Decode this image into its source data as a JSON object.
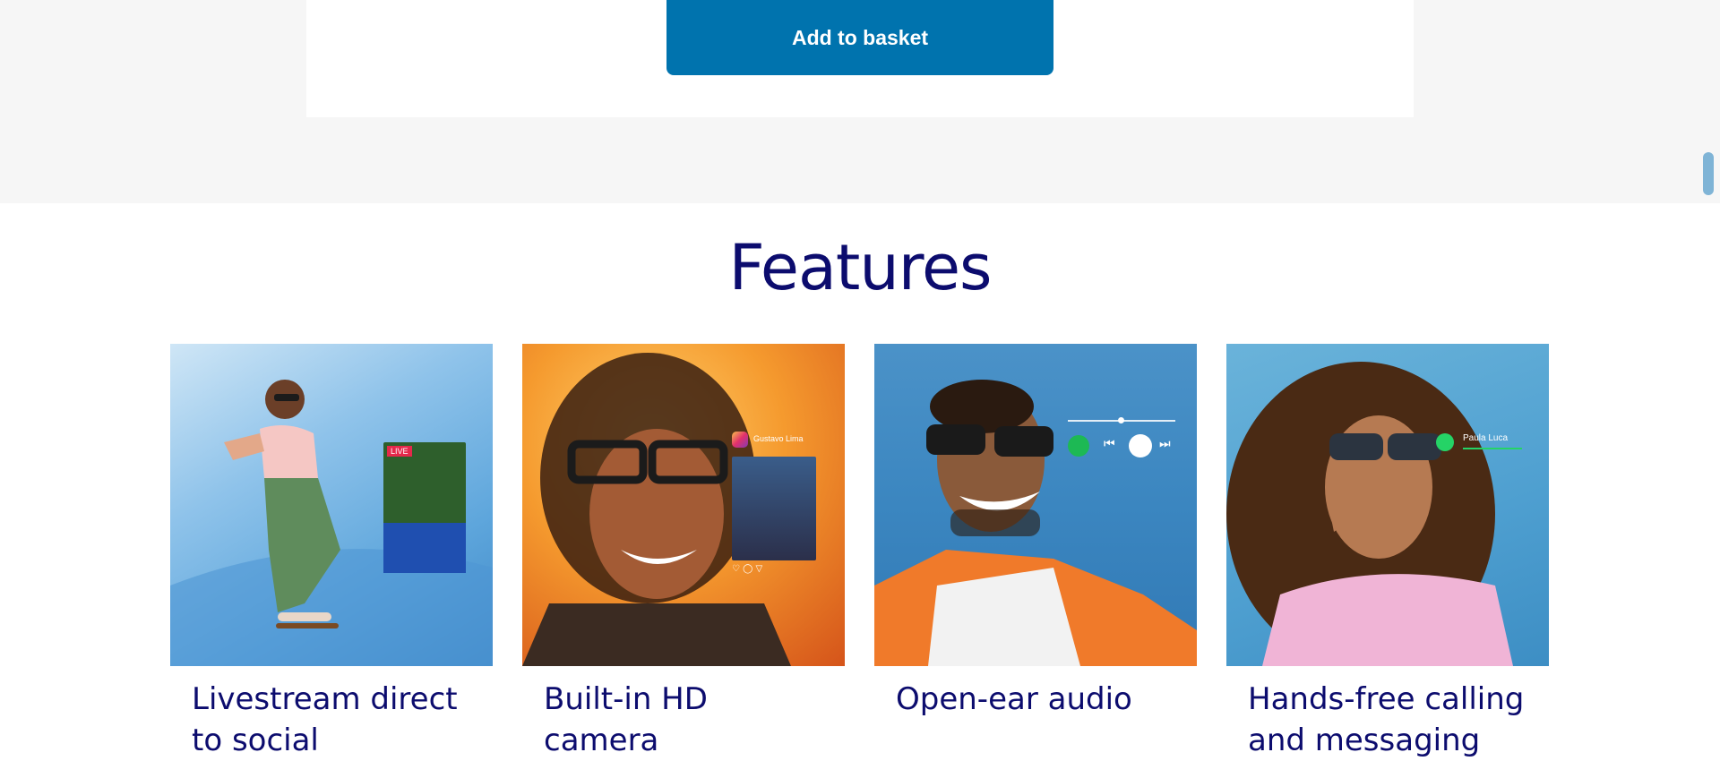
{
  "basket": {
    "button_label": "Add to basket"
  },
  "features": {
    "title": "Features",
    "items": [
      {
        "caption": "Livestream direct to social",
        "overlay_badge": "LIVE"
      },
      {
        "caption": "Built-in HD camera",
        "overlay_user": "Gustavo Lima"
      },
      {
        "caption": "Open-ear audio"
      },
      {
        "caption": "Hands-free calling and messaging",
        "overlay_user": "Paula Luca"
      }
    ]
  },
  "colors": {
    "accent": "#0073ae",
    "heading": "#0c0c6e",
    "band": "#f6f6f6"
  }
}
